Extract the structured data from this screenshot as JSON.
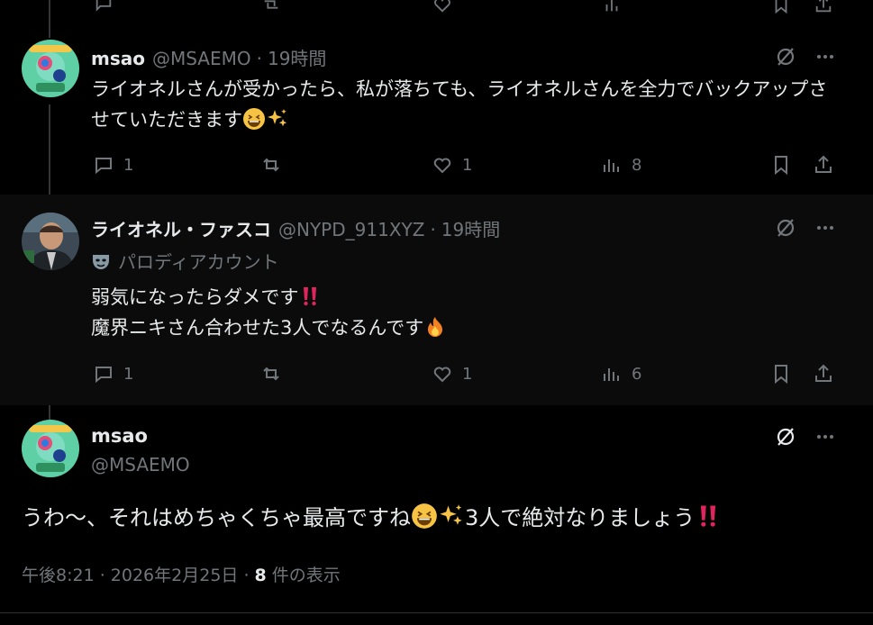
{
  "colors": {
    "background": "#000000",
    "reply_bg": "#0b0b0b",
    "text": "#e7e9ea",
    "muted": "#71767b",
    "red": "#e0245e"
  },
  "posts": [
    {
      "name": "msao",
      "handle": "@MSAEMO",
      "sep": "·",
      "time": "19時間",
      "text": "ライオネルさんが受かったら、私が落ちても、ライオネルさんを全力でバックアップさせていただきます",
      "trailing_emojis": [
        "grinning-squinting-face",
        "sparkles"
      ],
      "replies": "1",
      "likes": "1",
      "views": "8"
    },
    {
      "name": "ライオネル・ファスコ",
      "handle": "@NYPD_911XYZ",
      "sep": "·",
      "time": "19時間",
      "label_icon": "mask-icon",
      "label": "パロディアカウント",
      "line1": "弱気になったらダメです",
      "line2": "魔界ニキさん合わせた3人でなるんです",
      "line1_emoji": "double-exclamation",
      "line2_emoji": "fire",
      "replies": "1",
      "likes": "1",
      "views": "6"
    }
  ],
  "main": {
    "name": "msao",
    "handle": "@MSAEMO",
    "text_part1": "うわ〜、それはめちゃくちゃ最高ですね",
    "text_part2": "3人で絶対なりましょう",
    "emojis": [
      "grinning-squinting-face",
      "sparkles",
      "double-exclamation"
    ],
    "timestamp": "午後8:21 · 2026年2月25日 · ",
    "view_count": "8",
    "view_suffix": " 件の表示"
  }
}
